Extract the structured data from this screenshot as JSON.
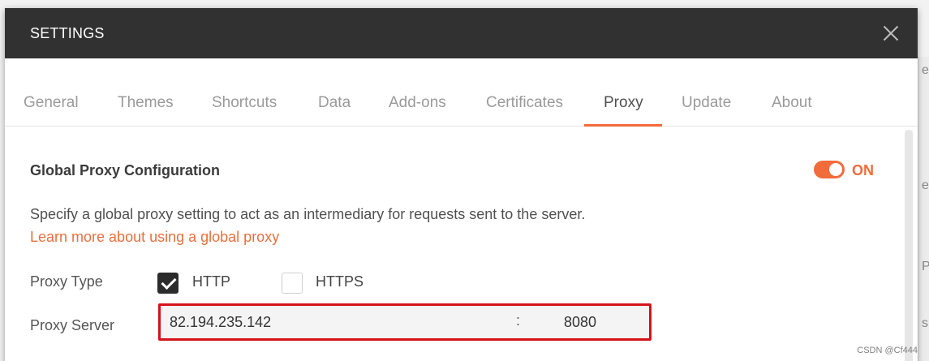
{
  "dialog": {
    "title": "SETTINGS"
  },
  "tabs": [
    {
      "label": "General"
    },
    {
      "label": "Themes"
    },
    {
      "label": "Shortcuts"
    },
    {
      "label": "Data"
    },
    {
      "label": "Add-ons"
    },
    {
      "label": "Certificates"
    },
    {
      "label": "Proxy"
    },
    {
      "label": "Update"
    },
    {
      "label": "About"
    }
  ],
  "active_tab": "Proxy",
  "proxy": {
    "section_title": "Global Proxy Configuration",
    "toggle_state": "ON",
    "description": "Specify a global proxy setting to act as an intermediary for requests sent to the server.",
    "learn_more": "Learn more about using a global proxy",
    "type_label": "Proxy Type",
    "http_label": "HTTP",
    "https_label": "HTTPS",
    "http_checked": true,
    "https_checked": false,
    "server_label": "Proxy Server",
    "server_host": "82.194.235.142",
    "server_port": "8080",
    "separator": ":"
  },
  "colors": {
    "accent": "#f26b3a",
    "titlebar": "#313131",
    "highlight": "#d4121a"
  },
  "watermark": "CSDN @Cf444"
}
